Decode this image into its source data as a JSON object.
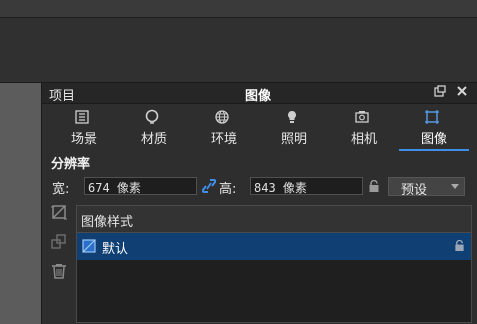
{
  "panel": {
    "left_tab": "项目",
    "title": "图像"
  },
  "tabs": [
    {
      "label": "场景",
      "icon": "scene-icon"
    },
    {
      "label": "材质",
      "icon": "material-icon"
    },
    {
      "label": "环境",
      "icon": "environment-icon"
    },
    {
      "label": "照明",
      "icon": "lighting-icon"
    },
    {
      "label": "相机",
      "icon": "camera-icon"
    },
    {
      "label": "图像",
      "icon": "image-icon",
      "active": true
    }
  ],
  "resolution": {
    "section_title": "分辨率",
    "width_label": "宽:",
    "width_value": "674 像素",
    "height_label": "高:",
    "height_value": "843 像素",
    "preset": "预设"
  },
  "image_styles": {
    "header": "图像样式",
    "items": [
      {
        "label": "默认",
        "locked": true,
        "selected": true
      }
    ]
  },
  "colors": {
    "accent": "#3f8ee8",
    "selected_row": "#0f3f73"
  }
}
